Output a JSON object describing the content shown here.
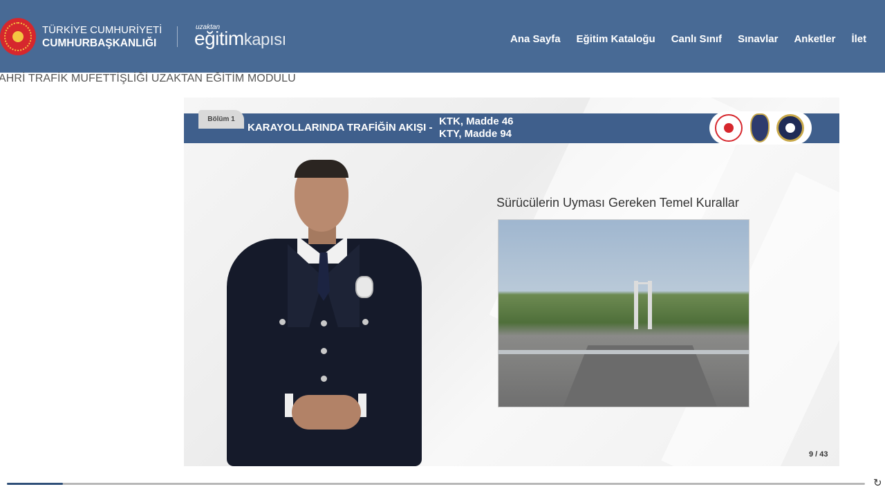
{
  "header": {
    "org_line1": "TÜRKİYE CUMHURİYETİ",
    "org_line2": "CUMHURBAŞKANLIĞI",
    "brand_small": "uzaktan",
    "brand_big_1": "eğitim",
    "brand_big_2": "kapısı",
    "nav": [
      {
        "label": "Ana Sayfa"
      },
      {
        "label": "Eğitim Kataloğu"
      },
      {
        "label": "Canlı Sınıf"
      },
      {
        "label": "Sınavlar"
      },
      {
        "label": "Anketler"
      },
      {
        "label": "İlet"
      }
    ],
    "colors": {
      "bar": "#486a95"
    }
  },
  "module": {
    "title": "AHRİ TRAFİK MUFETTİŞLİĞİ UZAKTAN EĞİTİM MODULU"
  },
  "slide": {
    "section_tab": "Bölüm 1",
    "banner_title": "KARAYOLLARINDA TRAFİĞİN AKIŞI -",
    "ref_line1": "KTK, Madde 46",
    "ref_line2": "KTY, Madde 94",
    "heading": "Sürücülerin Uyması Gereken Temel Kurallar",
    "page_counter": "9 / 43",
    "icons": [
      "emblem-logo",
      "police-badge-logo",
      "police-seal-logo"
    ]
  },
  "player": {
    "progress": 0.065,
    "replay_icon": "replay-icon"
  }
}
